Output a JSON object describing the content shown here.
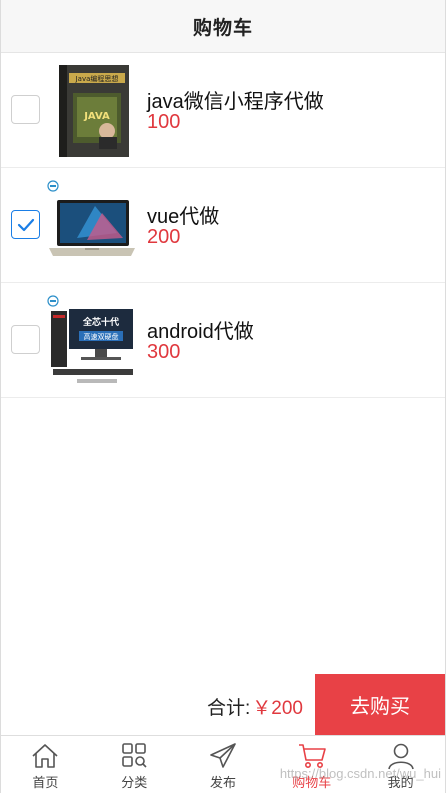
{
  "header": {
    "title": "购物车"
  },
  "items": [
    {
      "name": "java微信小程序代做",
      "price": "100",
      "checked": false,
      "image": "java-book-cover"
    },
    {
      "name": "vue代做",
      "price": "200",
      "checked": true,
      "image": "laptop-photo"
    },
    {
      "name": "android代做",
      "price": "300",
      "checked": false,
      "image": "desktop-pc-photo"
    }
  ],
  "book": {
    "cover_title": "Java编程思想",
    "cover_center": "JAVA"
  },
  "desktop": {
    "banner_top": "全芯十代",
    "banner_bottom": "高速双硬盘"
  },
  "checkout": {
    "total_label": "合计:",
    "total_value": "￥200",
    "buy_label": "去购买"
  },
  "tabs": [
    {
      "label": "首页",
      "icon": "home-icon",
      "active": false
    },
    {
      "label": "分类",
      "icon": "grid-category-icon",
      "active": false
    },
    {
      "label": "发布",
      "icon": "paper-plane-icon",
      "active": false
    },
    {
      "label": "购物车",
      "icon": "cart-icon",
      "active": true
    },
    {
      "label": "我的",
      "icon": "user-icon",
      "active": false
    }
  ],
  "watermark": "https://blog.csdn.net/wu_hui",
  "colors": {
    "accent": "#e84146",
    "price": "#e0383e",
    "checkbox_checked": "#1a7ee6"
  }
}
